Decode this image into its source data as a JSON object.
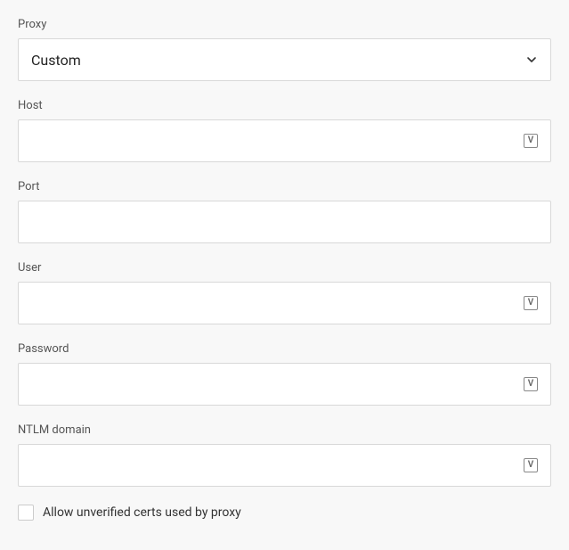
{
  "proxy": {
    "label": "Proxy",
    "selected": "Custom"
  },
  "host": {
    "label": "Host",
    "value": ""
  },
  "port": {
    "label": "Port",
    "value": ""
  },
  "user": {
    "label": "User",
    "value": ""
  },
  "password": {
    "label": "Password",
    "value": ""
  },
  "ntlm": {
    "label": "NTLM domain",
    "value": ""
  },
  "allow_unverified": {
    "label": "Allow unverified certs used by proxy",
    "checked": false
  },
  "icons": {
    "variable_badge": "V"
  }
}
